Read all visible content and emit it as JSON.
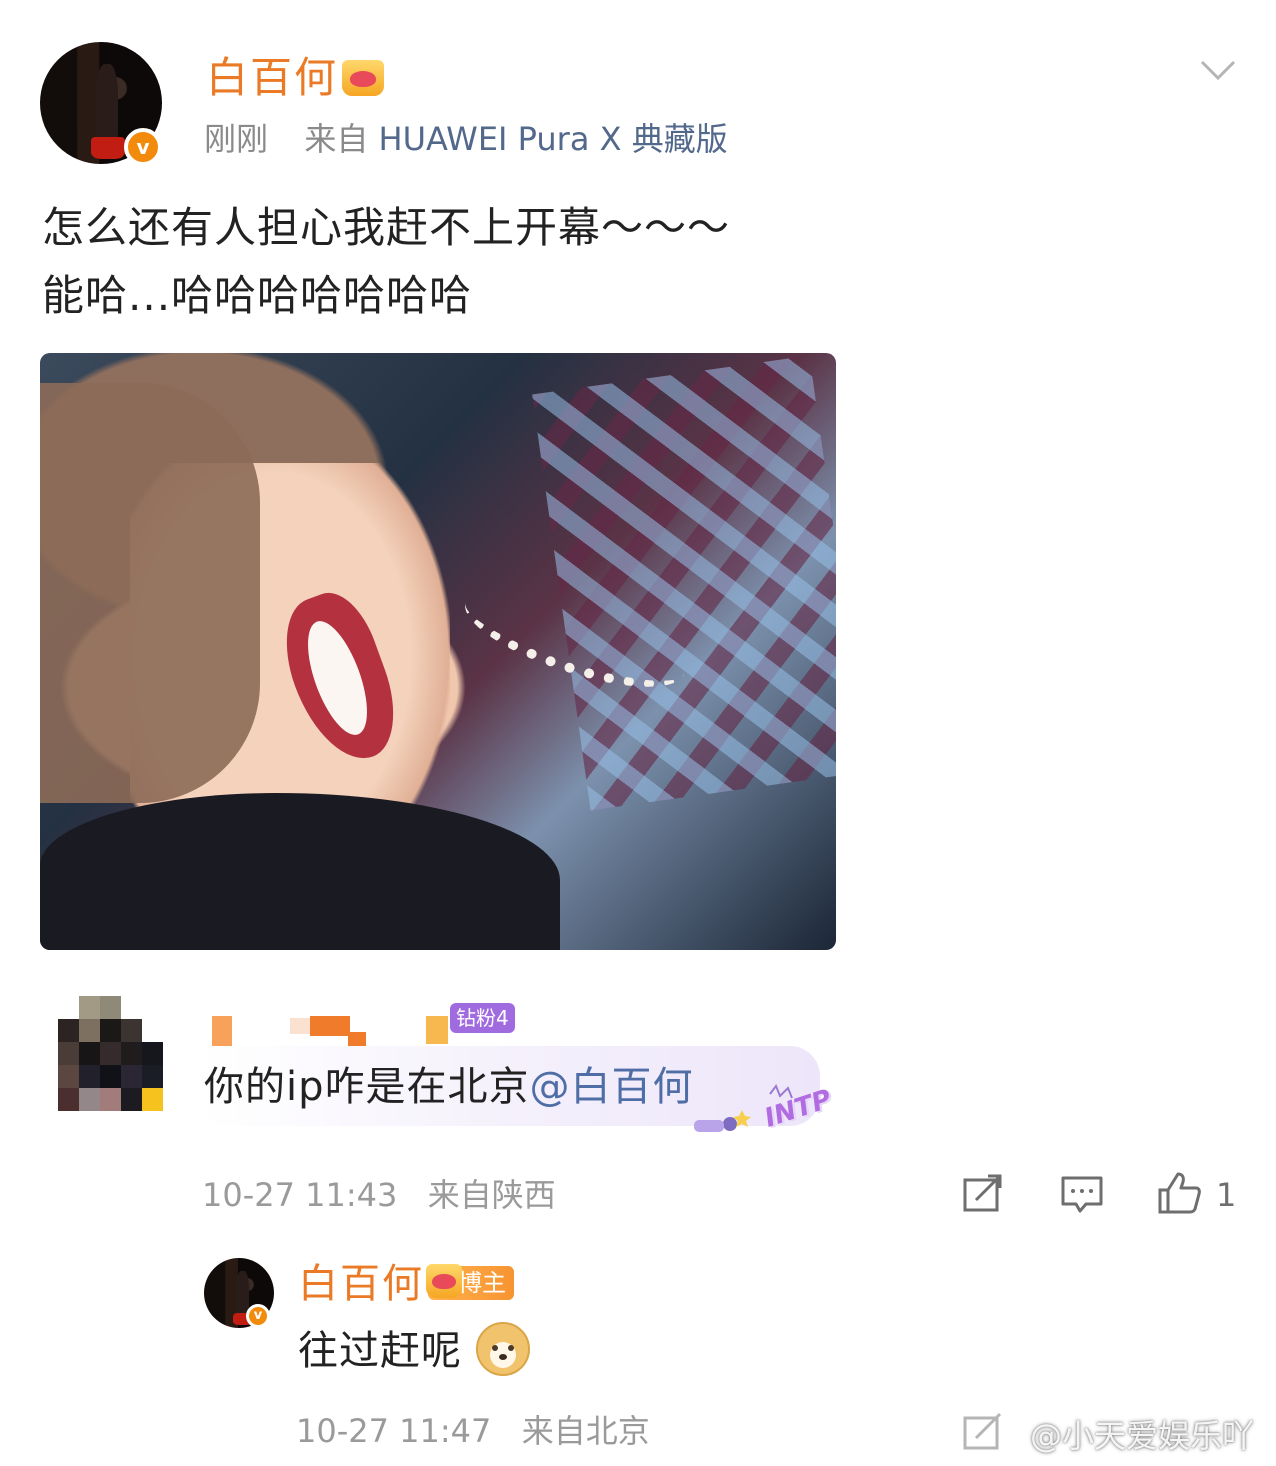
{
  "post": {
    "author": "白百何",
    "time": "刚刚",
    "source_prefix": "来自",
    "device": "HUAWEI Pura X 典藏版",
    "text_line1": "怎么还有人担心我赶不上开幕～～～",
    "text_line2": "能哈...哈哈哈哈哈哈哈"
  },
  "comment": {
    "fan_badge": "钻粉4",
    "text": "你的ip咋是在北京",
    "mention": "@白百何",
    "sticker": "INTP",
    "time": "10-27 11:43",
    "location": "来自陕西",
    "like_count": "1"
  },
  "reply": {
    "author": "白百何",
    "badge": "博主",
    "text": "往过赶呢",
    "time": "10-27 11:47",
    "location": "来自北京"
  },
  "watermark": "@小天爱娱乐吖",
  "icons": [
    "chevron-down-icon",
    "verified-v-icon",
    "crown-icon",
    "share-icon",
    "comment-icon",
    "like-icon",
    "doge-emoji-icon"
  ],
  "colors": {
    "name": "#ea7a25",
    "mention": "#4f6ea6",
    "fan_badge": "#a16be0",
    "verified": "#f28b0c"
  }
}
